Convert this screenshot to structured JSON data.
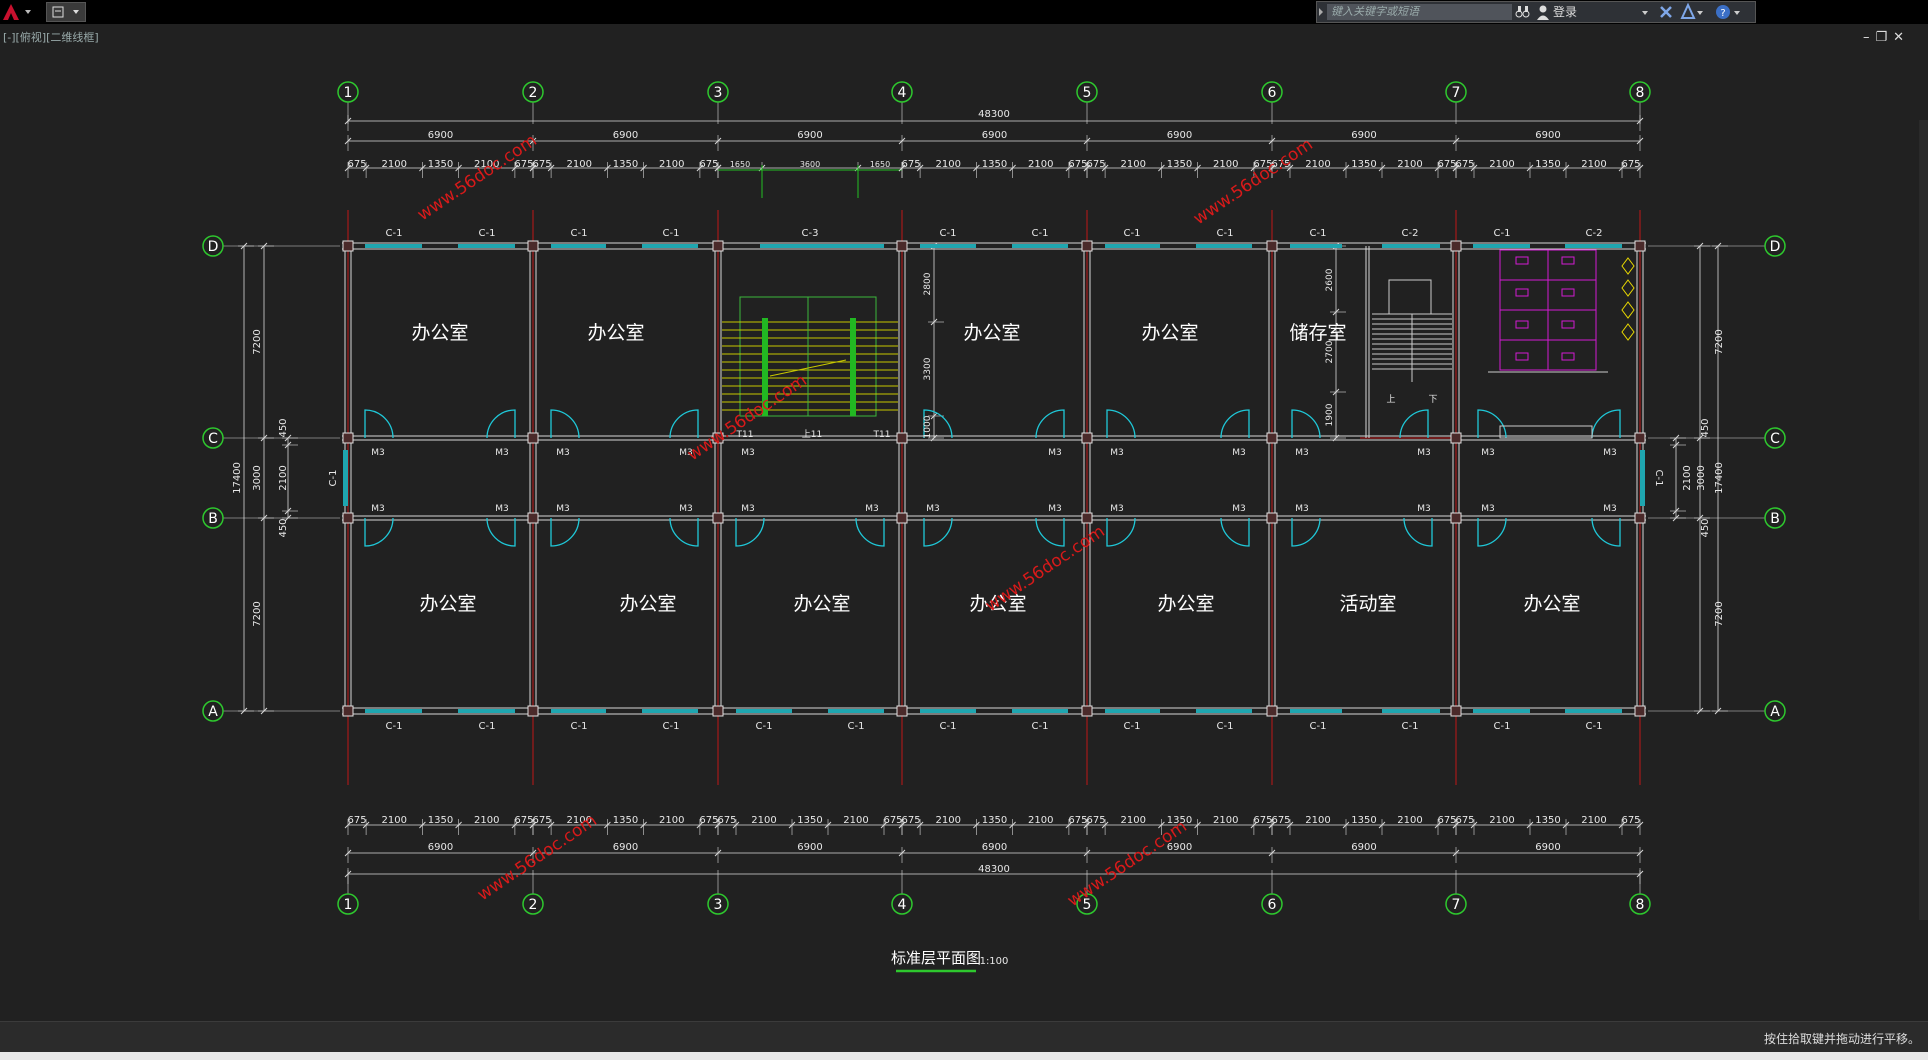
{
  "app": {
    "search_placeholder": "键入关键字或短语",
    "login_label": "登录",
    "view_label": "[-][俯视][二维线框]",
    "status_message": "按住拾取键并拖动进行平移。"
  },
  "drawing": {
    "title": "标准层平面图",
    "scale": "1:100",
    "axes_columns": [
      "1",
      "2",
      "3",
      "4",
      "5",
      "6",
      "7",
      "8"
    ],
    "axes_rows": [
      "D",
      "C",
      "B",
      "A"
    ],
    "total_length": "48300",
    "bay_width": "6900",
    "top_segments": [
      "675",
      "2100",
      "1350",
      "2100",
      "675"
    ],
    "stair_segments": [
      "1650",
      "3600",
      "1650"
    ],
    "total_depth": "17400",
    "row_depths": [
      "7200",
      "3000",
      "7200"
    ],
    "corridor_dims": [
      "450",
      "2100",
      "450"
    ],
    "stair_room_dims": [
      "2600",
      "2700",
      "1900"
    ],
    "stair_dims": [
      "2800",
      "3300",
      "1000"
    ],
    "rooms_top": [
      "办公室",
      "办公室",
      "办公室",
      "办公室",
      "储存室"
    ],
    "rooms_bottom": [
      "办公室",
      "办公室",
      "办公室",
      "办公室",
      "办公室",
      "活动室",
      "办公室"
    ],
    "window_labels": {
      "c1": "C-1",
      "c2": "C-2",
      "c3": "C-3"
    },
    "door_label": "M3",
    "stair_labels": {
      "up": "上",
      "down": "下",
      "t11": "T11",
      "s11": "上11"
    },
    "watermark": "www.56doc.com"
  }
}
